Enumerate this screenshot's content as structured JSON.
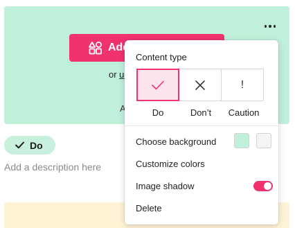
{
  "card": {
    "add_button_label": "Add",
    "alt_prefix": "or ",
    "alt_link": "u",
    "hint_text": "A",
    "bg_color": "#c0f0d9"
  },
  "badge": {
    "label": "Do"
  },
  "description_placeholder": "Add a description here",
  "menu": {
    "content_type_title": "Content type",
    "types": [
      {
        "label": "Do",
        "icon": "check-icon",
        "selected": true
      },
      {
        "label": "Don’t",
        "icon": "x-icon",
        "selected": false
      },
      {
        "label": "Caution",
        "icon": "exclamation-icon",
        "selected": false,
        "glyph": "!"
      }
    ],
    "choose_background": "Choose background",
    "background_swatches": [
      "#c0f0d9",
      "#f4f4f4"
    ],
    "customize_colors": "Customize colors",
    "image_shadow": "Image shadow",
    "image_shadow_on": true,
    "delete": "Delete"
  },
  "colors": {
    "accent": "#f0326f",
    "badge_bg": "#c7f1dc",
    "yellow_bg": "#fff3d6"
  }
}
